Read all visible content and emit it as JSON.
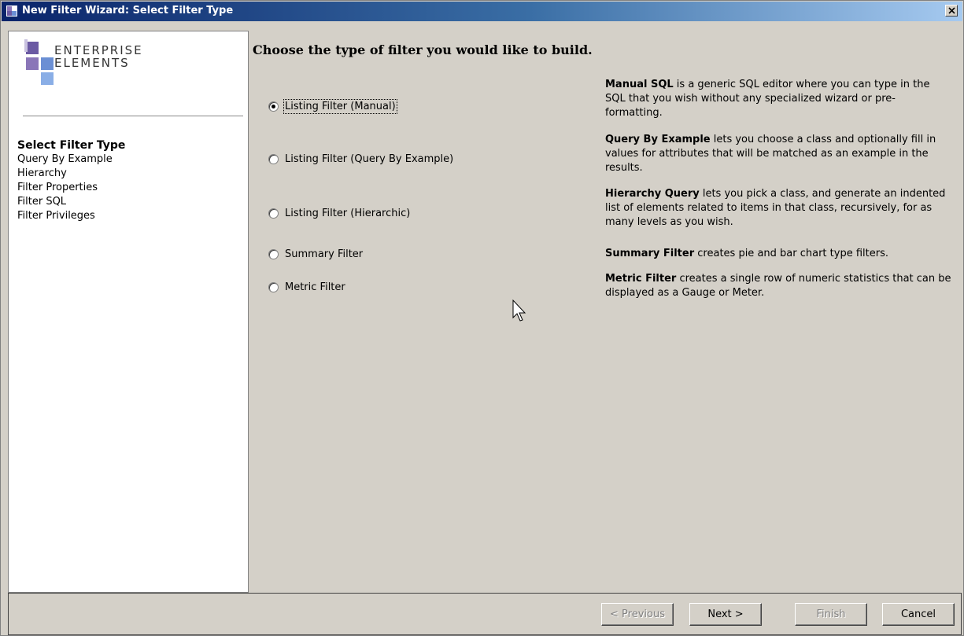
{
  "window": {
    "title": "New Filter Wizard: Select Filter Type"
  },
  "logo": {
    "line1": "ENTERPRISE",
    "line2": "ELEMENTS",
    "colors": [
      "#6b5aa3",
      "#8a76b8",
      "#6b8fd4",
      "#8aaee6"
    ]
  },
  "sidebar": {
    "steps": [
      {
        "label": "Select Filter Type",
        "active": true
      },
      {
        "label": "Query By Example"
      },
      {
        "label": "Hierarchy"
      },
      {
        "label": "Filter Properties"
      },
      {
        "label": "Filter SQL"
      },
      {
        "label": "Filter Privileges"
      }
    ]
  },
  "main": {
    "heading": "Choose the type of filter you would like to build.",
    "options": [
      {
        "label": "Listing Filter (Manual)",
        "selected": true,
        "desc_bold": "Manual SQL",
        "desc": " is a generic SQL editor where you can type in the SQL that you wish without any specialized wizard or pre-formatting."
      },
      {
        "label": "Listing Filter (Query By Example)",
        "desc_bold": "Query By Example",
        "desc": " lets you choose a class and optionally fill in values for attributes that will be matched as an example in the results."
      },
      {
        "label": "Listing Filter (Hierarchic)",
        "desc_bold": "Hierarchy Query",
        "desc": " lets you pick a class, and generate an indented list of elements related to items in that class, recursively, for as many levels as you wish."
      },
      {
        "label": "Summary Filter",
        "desc_bold": "Summary Filter",
        "desc": " creates pie and bar chart type filters."
      },
      {
        "label": "Metric Filter",
        "desc_bold": "Metric Filter",
        "desc": " creates a single row of numeric statistics that can be displayed as a Gauge or Meter."
      }
    ]
  },
  "buttons": {
    "previous": "< Previous",
    "next": "Next >",
    "finish": "Finish",
    "cancel": "Cancel"
  }
}
